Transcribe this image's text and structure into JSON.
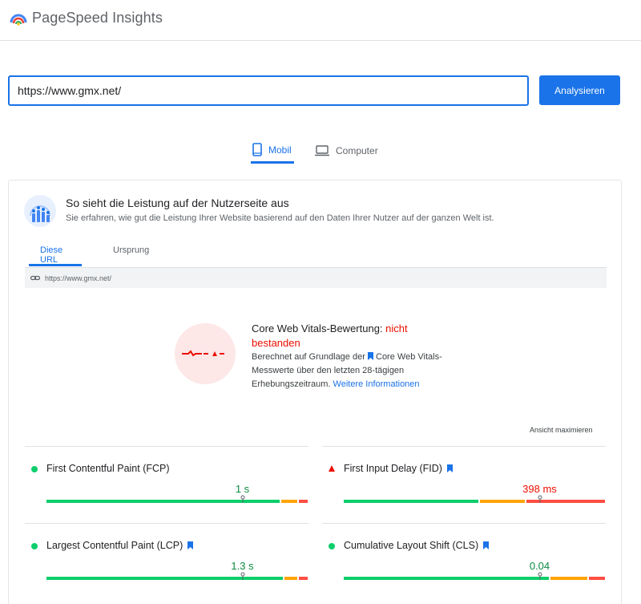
{
  "app": {
    "title": "PageSpeed Insights",
    "logo_icon": "pagespeed-logo-icon"
  },
  "search": {
    "value": "https://www.gmx.net/",
    "button_label": "Analysieren"
  },
  "device_tabs": [
    {
      "label": "Mobil",
      "icon": "smartphone-icon",
      "active": true
    },
    {
      "label": "Computer",
      "icon": "laptop-icon",
      "active": false
    }
  ],
  "field_data": {
    "title": "So sieht die Leistung auf der Nutzerseite aus",
    "subtitle": "Sie erfahren, wie gut die Leistung Ihrer Website basierend auf den Daten Ihrer Nutzer auf der ganzen Welt ist.",
    "tabs": [
      {
        "label": "Diese URL",
        "active": true
      },
      {
        "label": "Ursprung",
        "active": false
      }
    ],
    "url": "https://www.gmx.net/",
    "cwv": {
      "title_prefix": "Core Web Vitals-Bewertung:",
      "status": "nicht bestanden",
      "desc_prefix": "Berechnet auf Grundlage der",
      "desc_link_text": "Core Web Vitals-",
      "desc_middle": "Messwerte über den letzten 28-tägigen Erhebungszeitraum.",
      "more_info": "Weitere Informationen"
    },
    "expand_label": "Ansicht maximieren",
    "metrics": [
      {
        "label": "First Contentful Paint (FCP)",
        "value": "1 s",
        "rating": "good",
        "bookmark": false,
        "distribution": {
          "good": 0.9,
          "needs_improvement": 0.065,
          "poor": 0.035
        },
        "marker": 0.75
      },
      {
        "label": "First Input Delay (FID)",
        "value": "398 ms",
        "rating": "poor",
        "bookmark": true,
        "distribution": {
          "good": 0.52,
          "needs_improvement": 0.18,
          "poor": 0.3
        },
        "marker": 0.75
      },
      {
        "label": "Largest Contentful Paint (LCP)",
        "value": "1.3 s",
        "rating": "good",
        "bookmark": true,
        "distribution": {
          "good": 0.91,
          "needs_improvement": 0.055,
          "poor": 0.035
        },
        "marker": 0.75
      },
      {
        "label": "Cumulative Layout Shift (CLS)",
        "value": "0.04",
        "rating": "good",
        "bookmark": true,
        "distribution": {
          "good": 0.79,
          "needs_improvement": 0.15,
          "poor": 0.06
        },
        "marker": 0.75
      }
    ]
  },
  "colors": {
    "accent": "#1a73e8",
    "good": "#0cce6b",
    "needs_improvement": "#ffa400",
    "poor": "#ff4e42",
    "fail_text": "#eb0f00"
  }
}
